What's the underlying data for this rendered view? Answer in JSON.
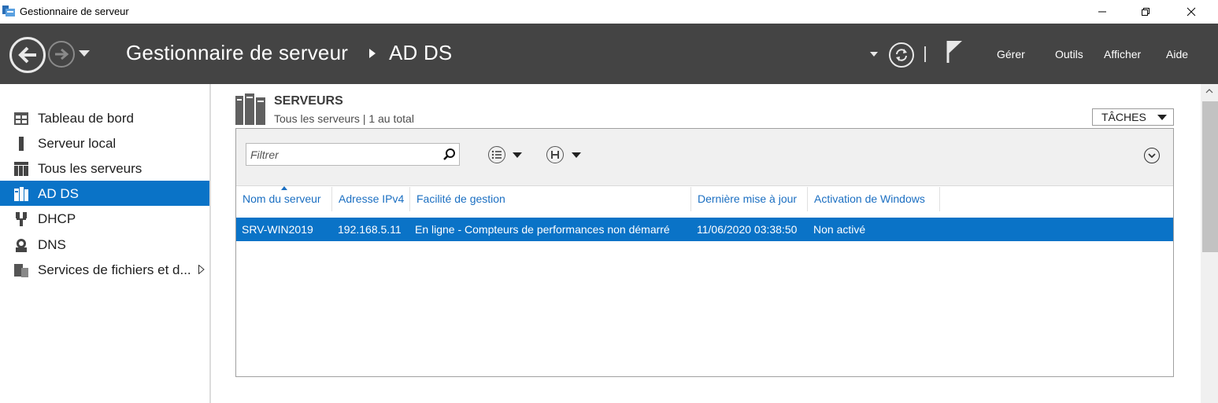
{
  "window": {
    "title": "Gestionnaire de serveur",
    "controls": [
      "minimize-icon",
      "restore-icon",
      "close-icon"
    ]
  },
  "header": {
    "breadcrumb_root": "Gestionnaire de serveur",
    "breadcrumb_current": "AD DS",
    "menu": [
      "Gérer",
      "Outils",
      "Afficher",
      "Aide"
    ],
    "background_color": "#444444"
  },
  "sidebar": {
    "items": [
      {
        "label": "Tableau de bord",
        "icon": "dashboard-icon"
      },
      {
        "label": "Serveur local",
        "icon": "local-server-icon"
      },
      {
        "label": "Tous les serveurs",
        "icon": "all-servers-icon"
      },
      {
        "label": "AD DS",
        "icon": "ad-ds-icon",
        "active": true
      },
      {
        "label": "DHCP",
        "icon": "dhcp-icon"
      },
      {
        "label": "DNS",
        "icon": "dns-icon"
      },
      {
        "label": "Services de fichiers et d...",
        "icon": "file-services-icon",
        "has_submenu": true
      }
    ],
    "active_color": "#0a73c7"
  },
  "section": {
    "title": "SERVEURS",
    "subtitle": "Tous les serveurs | 1 au total",
    "tasks_label": "TÂCHES"
  },
  "toolbar": {
    "filter_placeholder": "Filtrer"
  },
  "table": {
    "columns": [
      "Nom du serveur",
      "Adresse IPv4",
      "Facilité de gestion",
      "Dernière mise à jour",
      "Activation de Windows"
    ],
    "rows": [
      {
        "name": "SRV-WIN2019",
        "ipv4": "192.168.5.11",
        "manageability": "En ligne - Compteurs de performances non démarré",
        "last_update": "11/06/2020 03:38:50",
        "activation": "Non activé",
        "selected": true
      }
    ]
  }
}
